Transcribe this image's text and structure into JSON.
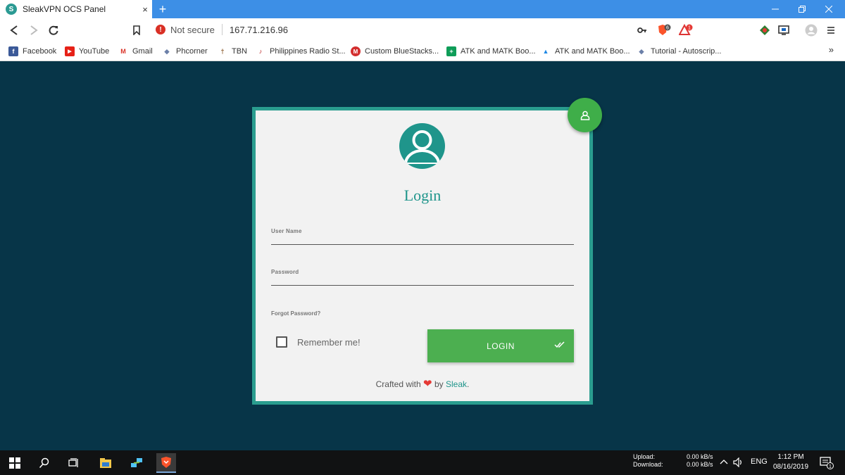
{
  "browser": {
    "tab_title": "SleakVPN OCS Panel",
    "tab_favicon": "S",
    "tab_close": "×",
    "new_tab": "+",
    "security_icon_text": "!",
    "security_label": "Not secure",
    "url": "167.71.216.96",
    "shield_badge": "6",
    "alert_badge": "1"
  },
  "bookmarks": [
    {
      "label": "Facebook",
      "color": "#3b5998",
      "glyph": "f"
    },
    {
      "label": "YouTube",
      "color": "#e62117",
      "glyph": "▶"
    },
    {
      "label": "Gmail",
      "color": "#ffffff",
      "glyph": "M"
    },
    {
      "label": "Phcorner",
      "color": "#7a7a7a",
      "glyph": "◆"
    },
    {
      "label": "TBN",
      "color": "#ffffff",
      "glyph": "†"
    },
    {
      "label": "Philippines Radio St...",
      "color": "#ffffff",
      "glyph": "♪"
    },
    {
      "label": "Custom BlueStacks...",
      "color": "#d32f2f",
      "glyph": "M"
    },
    {
      "label": "ATK and MATK Boo...",
      "color": "#0f9d58",
      "glyph": "+"
    },
    {
      "label": "ATK and MATK Boo...",
      "color": "#ffffff",
      "glyph": "▲"
    },
    {
      "label": "Tutorial - Autoscrip...",
      "color": "#7a7a7a",
      "glyph": "◆"
    }
  ],
  "bookmarks_more": "»",
  "login": {
    "title": "Login",
    "username_label": "User Name",
    "password_label": "Password",
    "forgot_label": "Forgot Password?",
    "remember_label": "Remember me!",
    "button_label": "LOGIN",
    "footer_prefix": "Crafted with",
    "footer_heart": "❤",
    "footer_by": "by",
    "footer_brand": "Sleak",
    "footer_suffix": "."
  },
  "colors": {
    "background": "#073548",
    "card_border": "#2a9d8f",
    "accent": "#1f958b",
    "button": "#4caf50",
    "fab": "#3fae49"
  },
  "taskbar": {
    "upload_label": "Upload:",
    "download_label": "Download:",
    "upload_value": "0.00 kB/s",
    "download_value": "0.00 kB/s",
    "language": "ENG",
    "time": "1:12 PM",
    "date": "08/16/2019",
    "notification_badge": "1"
  }
}
